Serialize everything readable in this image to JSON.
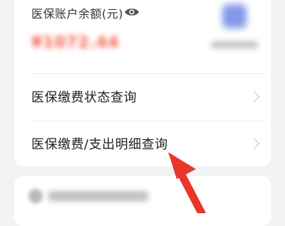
{
  "balance": {
    "label": "医保账户余额(元)",
    "amount": "¥1072.44",
    "visibility_icon": "eye-icon"
  },
  "promo": {
    "icon": "service-icon",
    "label": ""
  },
  "menu": {
    "items": [
      {
        "label": "医保缴费状态查询",
        "icon": "chevron-right-icon"
      },
      {
        "label": "医保缴费/支出明细查询",
        "icon": "chevron-right-icon"
      }
    ]
  },
  "bottom_section": {
    "label": ""
  },
  "colors": {
    "background": "#f2f3f5",
    "card": "#ffffff",
    "amount": "#f25c4a",
    "promo_icon": "#6d86e6",
    "annotation_arrow": "#e8362b"
  }
}
